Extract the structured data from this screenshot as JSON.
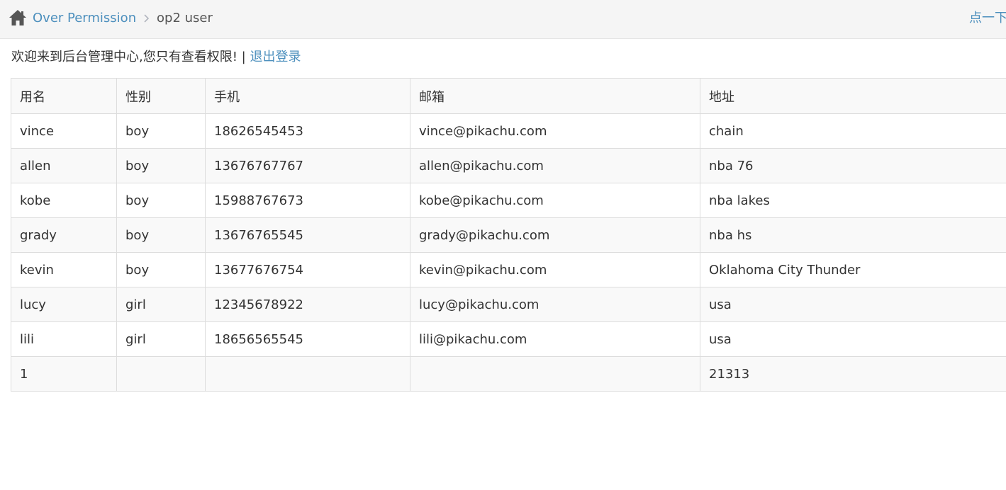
{
  "breadcrumb": {
    "home_icon": "home-icon",
    "parent": "Over Permission",
    "separator_icon": "chevron-right-icon",
    "current": "op2 user"
  },
  "top_right_link": "点一下",
  "welcome": {
    "message": "欢迎来到后台管理中心,您只有查看权限!",
    "divider": "|",
    "logout": "退出登录"
  },
  "table": {
    "headers": [
      "用名",
      "性别",
      "手机",
      "邮箱",
      "地址"
    ],
    "rows": [
      [
        "vince",
        "boy",
        "18626545453",
        "vince@pikachu.com",
        "chain"
      ],
      [
        "allen",
        "boy",
        "13676767767",
        "allen@pikachu.com",
        "nba 76"
      ],
      [
        "kobe",
        "boy",
        "15988767673",
        "kobe@pikachu.com",
        "nba lakes"
      ],
      [
        "grady",
        "boy",
        "13676765545",
        "grady@pikachu.com",
        "nba hs"
      ],
      [
        "kevin",
        "boy",
        "13677676754",
        "kevin@pikachu.com",
        "Oklahoma City Thunder"
      ],
      [
        "lucy",
        "girl",
        "12345678922",
        "lucy@pikachu.com",
        "usa"
      ],
      [
        "lili",
        "girl",
        "18656565545",
        "lili@pikachu.com",
        "usa"
      ],
      [
        "1",
        "",
        "",
        "",
        "21313"
      ]
    ]
  },
  "colors": {
    "link": "#4c8fbd",
    "breadcrumb_bg": "#f5f5f5",
    "border": "#dddddd",
    "stripe": "#f9f9f9"
  }
}
